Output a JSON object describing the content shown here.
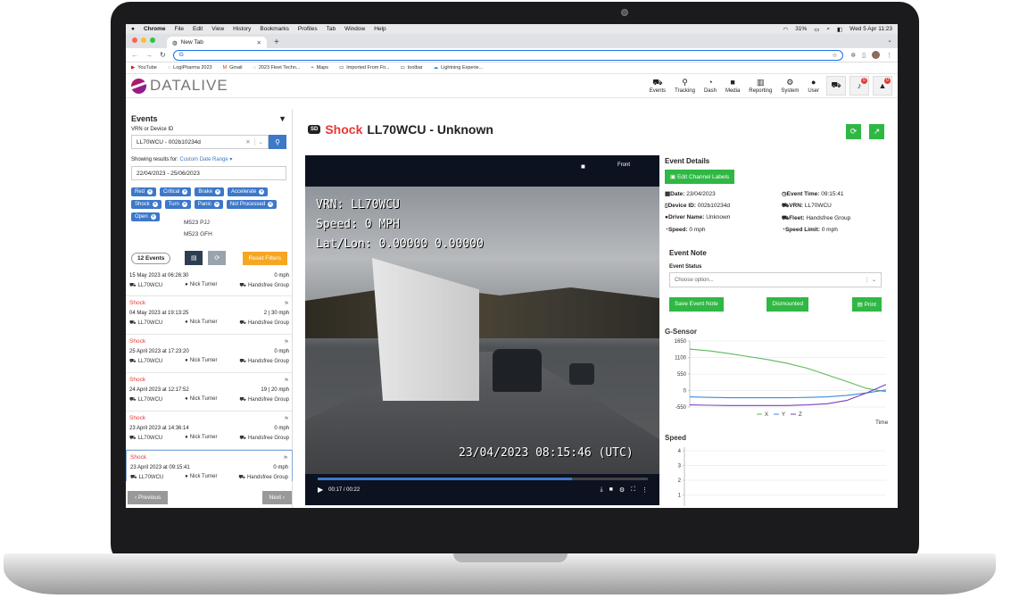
{
  "mac_menu": {
    "app": "Chrome",
    "items": [
      "File",
      "Edit",
      "View",
      "History",
      "Bookmarks",
      "Profiles",
      "Tab",
      "Window",
      "Help"
    ],
    "battery": "31%",
    "clock": "Wed 5 Apr  11:23"
  },
  "browser": {
    "tab_title": "New Tab",
    "address": "",
    "bookmarks": [
      "YouTube",
      "LogiPharma 2023",
      "Gmail",
      "2023 Fleet Techn...",
      "Maps",
      "Imported From Fir...",
      "toolbar",
      "Lightning Experie..."
    ]
  },
  "app": {
    "logo": "DATALIVE",
    "nav": [
      "Events",
      "Tracking",
      "Dash",
      "Media",
      "Reporting",
      "System",
      "User"
    ],
    "alerts": {
      "notifications": "0",
      "warnings": "0"
    }
  },
  "sidebar": {
    "title": "Events",
    "vrn_label": "VRN or Device ID",
    "vrn_value": "LL70WCU - 002b10234d",
    "showing_label": "Showing results for:",
    "range_label": "Custom Date Range",
    "date_range": "22/04/2023 - 25/06/2023",
    "filters": [
      "Red",
      "Critical",
      "Brake",
      "Accelerate",
      "Shock",
      "Turn",
      "Panic",
      "Not Processed",
      "Open"
    ],
    "plates": [
      "M523 PJJ",
      "M523 GFH"
    ],
    "count": "12 Events",
    "reset": "Reset Filters",
    "events": [
      {
        "type": "",
        "datetime": "15 May 2023 at 06:26:30",
        "speed": "0 mph",
        "vrn": "LL70WCU",
        "driver": "Nick Turner",
        "fleet": "Handsfree Group"
      },
      {
        "type": "Shock",
        "datetime": "04 May 2023 at 19:13:25",
        "speed": "2 | 30 mph",
        "vrn": "LL70WCU",
        "driver": "Nick Turner",
        "fleet": "Handsfree Group"
      },
      {
        "type": "Shock",
        "datetime": "25 April 2023 at 17:23:20",
        "speed": "0 mph",
        "vrn": "LL70WCU",
        "driver": "Nick Turner",
        "fleet": "Handsfree Group"
      },
      {
        "type": "Shock",
        "datetime": "24 April 2023 at 12:17:52",
        "speed": "19 | 20 mph",
        "vrn": "LL70WCU",
        "driver": "Nick Turner",
        "fleet": "Handsfree Group"
      },
      {
        "type": "Shock",
        "datetime": "23 April 2023 at 14:36:14",
        "speed": "0 mph",
        "vrn": "LL70WCU",
        "driver": "Nick Turner",
        "fleet": "Handsfree Group"
      },
      {
        "type": "Shock",
        "datetime": "23 April 2023 at 09:15:41",
        "speed": "0 mph",
        "vrn": "LL70WCU",
        "driver": "Nick Turner",
        "fleet": "Handsfree Group"
      }
    ],
    "prev": "Previous",
    "next": "Next"
  },
  "event": {
    "badge": "SD",
    "type": "Shock",
    "title": "LL70WCU - Unknown",
    "video": {
      "channel": "Front",
      "overlay_vrn": "VRN: LL70WCU",
      "overlay_speed": "Speed: 0 MPH",
      "overlay_latlon": "Lat/Lon: 0.00000 0.00000",
      "overlay_time": "23/04/2023 08:15:46 (UTC)",
      "time": "00:17 / 00:22",
      "progress": 0.77
    },
    "details_title": "Event Details",
    "edit_labels": "Edit Channel Labels",
    "fields": [
      {
        "k": "Date:",
        "v": "23/04/2023"
      },
      {
        "k": "Event Time:",
        "v": "09:15:41"
      },
      {
        "k": "Device ID:",
        "v": "002b10234d"
      },
      {
        "k": "VRN:",
        "v": "LL70WCU"
      },
      {
        "k": "Driver Name:",
        "v": "Unknown"
      },
      {
        "k": "Fleet:",
        "v": "Handsfree Group"
      },
      {
        "k": "Speed:",
        "v": "0 mph"
      },
      {
        "k": "Speed Limit:",
        "v": "0 mph"
      }
    ],
    "note_title": "Event Note",
    "status_label": "Event Status",
    "status_placeholder": "Choose option...",
    "save": "Save Event Note",
    "dismount": "Dismounted",
    "print": "Print"
  },
  "chart_data": [
    {
      "type": "line",
      "title": "G-Sensor",
      "xlabel": "Time",
      "yticks": [
        "1650",
        "1100",
        "550",
        "0",
        "-550"
      ],
      "ylim": [
        -550,
        1650
      ],
      "series": [
        {
          "name": "X",
          "color": "#5cb85c",
          "values": [
            1380,
            1320,
            1230,
            1130,
            1030,
            900,
            740,
            520,
            300,
            70,
            -40
          ]
        },
        {
          "name": "Y",
          "color": "#3d8bd9",
          "values": [
            -210,
            -230,
            -240,
            -240,
            -240,
            -240,
            -230,
            -210,
            -160,
            -80,
            20
          ]
        },
        {
          "name": "Z",
          "color": "#7b3fc0",
          "values": [
            -480,
            -490,
            -500,
            -500,
            -500,
            -500,
            -480,
            -440,
            -330,
            -80,
            200
          ]
        }
      ]
    },
    {
      "type": "line",
      "title": "Speed",
      "xlabel": "",
      "yticks": [
        "4",
        "3",
        "2",
        "1"
      ],
      "ylim": [
        0,
        4
      ],
      "series": []
    }
  ]
}
